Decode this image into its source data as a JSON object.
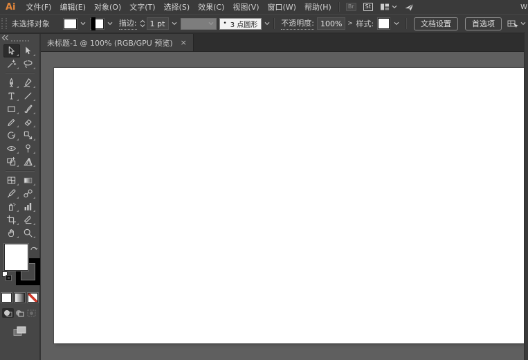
{
  "window": {
    "edge_hint": "W"
  },
  "menubar": {
    "logo": "Ai",
    "items": [
      "文件(F)",
      "编辑(E)",
      "对象(O)",
      "文字(T)",
      "选择(S)",
      "效果(C)",
      "视图(V)",
      "窗口(W)",
      "帮助(H)"
    ],
    "bridge_label": "Br",
    "stock_label": "St"
  },
  "controlbar": {
    "status_text": "未选择对象",
    "stroke_label": "描边:",
    "stroke_weight_value": "1 pt",
    "brush_bullet": "•",
    "brush_definition": "3 点圆形",
    "opacity_label": "不透明度:",
    "opacity_value": "100%",
    "opacity_expand": ">",
    "style_label": "样式:",
    "document_setup_label": "文档设置",
    "preferences_label": "首选项"
  },
  "tabbar": {
    "tabs": [
      {
        "title": "未标题-1 @ 100% (RGB/GPU 预览)",
        "close_glyph": "×",
        "active": true
      }
    ]
  },
  "toolbar": {
    "tools": [
      {
        "icon": "selection-tool-icon",
        "active": true
      },
      {
        "icon": "direct-selection-tool-icon"
      },
      {
        "icon": "magic-wand-icon"
      },
      {
        "icon": "lasso-icon"
      },
      {
        "icon": "pen-tool-icon"
      },
      {
        "icon": "curvature-tool-icon"
      },
      {
        "icon": "type-tool-icon"
      },
      {
        "icon": "line-segment-icon"
      },
      {
        "icon": "rectangle-tool-icon"
      },
      {
        "icon": "paintbrush-icon"
      },
      {
        "icon": "shaper-pencil-icon"
      },
      {
        "icon": "eraser-icon"
      },
      {
        "icon": "rotate-tool-icon"
      },
      {
        "icon": "scale-tool-icon"
      },
      {
        "icon": "width-tool-icon"
      },
      {
        "icon": "puppet-warp-icon"
      },
      {
        "icon": "shape-builder-icon"
      },
      {
        "icon": "perspective-grid-icon"
      },
      {
        "icon": "mesh-tool-icon"
      },
      {
        "icon": "gradient-tool-icon"
      },
      {
        "icon": "eyedropper-icon"
      },
      {
        "icon": "blend-tool-icon"
      },
      {
        "icon": "symbol-sprayer-icon"
      },
      {
        "icon": "column-graph-icon"
      },
      {
        "icon": "artboard-tool-icon"
      },
      {
        "icon": "slice-tool-icon"
      },
      {
        "icon": "hand-tool-icon"
      },
      {
        "icon": "zoom-tool-icon"
      }
    ],
    "divider_after": [
      3,
      17
    ]
  },
  "proxies": {
    "fill_color": "#ffffff",
    "stroke_color": "#000000"
  },
  "colors": {
    "logo_accent": "#e2863b",
    "bar_background": "#3b3b3b",
    "toolbar_background": "#464646",
    "pasteboard": "#5f5f5f",
    "artboard": "#ffffff",
    "none_swatch_red": "#d03a2b"
  }
}
